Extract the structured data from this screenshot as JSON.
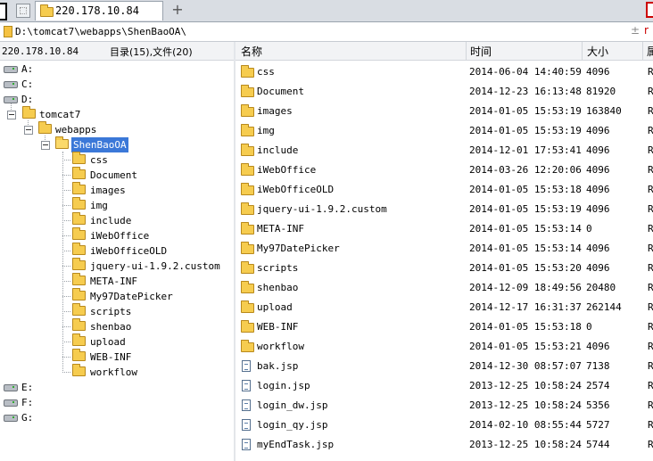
{
  "tab": {
    "title": "220.178.10.84",
    "new_tab_label": "+"
  },
  "pathbar": {
    "path": "D:\\tomcat7\\webapps\\ShenBaoOA\\",
    "sep": "±",
    "right_glyph": "r"
  },
  "tree": {
    "host": "220.178.10.84",
    "count_label": "目录(15),文件(20)",
    "drives_top": [
      "A:",
      "C:",
      "D:"
    ],
    "tomcat": "tomcat7",
    "webapps": "webapps",
    "selected": "ShenBaoOA",
    "children": [
      "css",
      "Document",
      "images",
      "img",
      "include",
      "iWebOffice",
      "iWebOfficeOLD",
      "jquery-ui-1.9.2.custom",
      "META-INF",
      "My97DatePicker",
      "scripts",
      "shenbao",
      "upload",
      "WEB-INF",
      "workflow"
    ],
    "drives_bottom": [
      "E:",
      "F:",
      "G:"
    ]
  },
  "list": {
    "headers": {
      "name": "名称",
      "time": "时间",
      "size": "大小",
      "extra": "属"
    },
    "rows": [
      {
        "name": "css",
        "time": "2014-06-04 14:40:59",
        "size": "4096",
        "extra": "R",
        "type": "folder"
      },
      {
        "name": "Document",
        "time": "2014-12-23 16:13:48",
        "size": "81920",
        "extra": "R",
        "type": "folder"
      },
      {
        "name": "images",
        "time": "2014-01-05 15:53:19",
        "size": "163840",
        "extra": "R",
        "type": "folder"
      },
      {
        "name": "img",
        "time": "2014-01-05 15:53:19",
        "size": "4096",
        "extra": "R",
        "type": "folder"
      },
      {
        "name": "include",
        "time": "2014-12-01 17:53:41",
        "size": "4096",
        "extra": "R",
        "type": "folder"
      },
      {
        "name": "iWebOffice",
        "time": "2014-03-26 12:20:06",
        "size": "4096",
        "extra": "R",
        "type": "folder"
      },
      {
        "name": "iWebOfficeOLD",
        "time": "2014-01-05 15:53:18",
        "size": "4096",
        "extra": "R",
        "type": "folder"
      },
      {
        "name": "jquery-ui-1.9.2.custom",
        "time": "2014-01-05 15:53:19",
        "size": "4096",
        "extra": "R",
        "type": "folder"
      },
      {
        "name": "META-INF",
        "time": "2014-01-05 15:53:14",
        "size": "0",
        "extra": "R",
        "type": "folder"
      },
      {
        "name": "My97DatePicker",
        "time": "2014-01-05 15:53:14",
        "size": "4096",
        "extra": "R",
        "type": "folder"
      },
      {
        "name": "scripts",
        "time": "2014-01-05 15:53:20",
        "size": "4096",
        "extra": "R",
        "type": "folder"
      },
      {
        "name": "shenbao",
        "time": "2014-12-09 18:49:56",
        "size": "20480",
        "extra": "R",
        "type": "folder"
      },
      {
        "name": "upload",
        "time": "2014-12-17 16:31:37",
        "size": "262144",
        "extra": "R",
        "type": "folder"
      },
      {
        "name": "WEB-INF",
        "time": "2014-01-05 15:53:18",
        "size": "0",
        "extra": "R",
        "type": "folder"
      },
      {
        "name": "workflow",
        "time": "2014-01-05 15:53:21",
        "size": "4096",
        "extra": "R",
        "type": "folder"
      },
      {
        "name": "bak.jsp",
        "time": "2014-12-30 08:57:07",
        "size": "7138",
        "extra": "R",
        "type": "file"
      },
      {
        "name": "login.jsp",
        "time": "2013-12-25 10:58:24",
        "size": "2574",
        "extra": "R",
        "type": "file"
      },
      {
        "name": "login_dw.jsp",
        "time": "2013-12-25 10:58:24",
        "size": "5356",
        "extra": "R",
        "type": "file"
      },
      {
        "name": "login_qy.jsp",
        "time": "2014-02-10 08:55:44",
        "size": "5727",
        "extra": "R",
        "type": "file"
      },
      {
        "name": "myEndTask.jsp",
        "time": "2013-12-25 10:58:24",
        "size": "5744",
        "extra": "R",
        "type": "file"
      }
    ]
  }
}
